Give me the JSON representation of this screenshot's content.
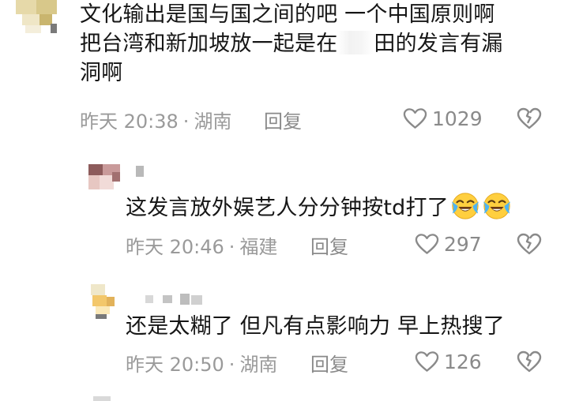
{
  "comments": [
    {
      "text_lines": [
        "文化输出是国与国之间的吧 一个中国原则啊",
        "把台湾和新加坡放一起是在",
        "田的发言有漏",
        "洞啊"
      ],
      "time": "昨天 20:38",
      "sep": "·",
      "location": "湖南",
      "reply": "回复",
      "likes": "1029"
    },
    {
      "text": "这发言放外娱艺人分分钟按td打了",
      "emojis": [
        "crying-laughing-emoji",
        "crying-laughing-emoji"
      ],
      "time": "昨天 20:46",
      "sep": "·",
      "location": "福建",
      "reply": "回复",
      "likes": "297"
    },
    {
      "text": "还是太糊了 但凡有点影响力 早上热搜了",
      "time": "昨天 20:50",
      "sep": "·",
      "location": "湖南",
      "reply": "回复",
      "likes": "126"
    }
  ],
  "icons": {
    "like": "heart-outline-icon",
    "dislike": "broken-heart-outline-icon"
  },
  "colors": {
    "text": "#161616",
    "meta": "#9a9a9a",
    "icon": "#8a8a8a",
    "background": "#ffffff"
  }
}
